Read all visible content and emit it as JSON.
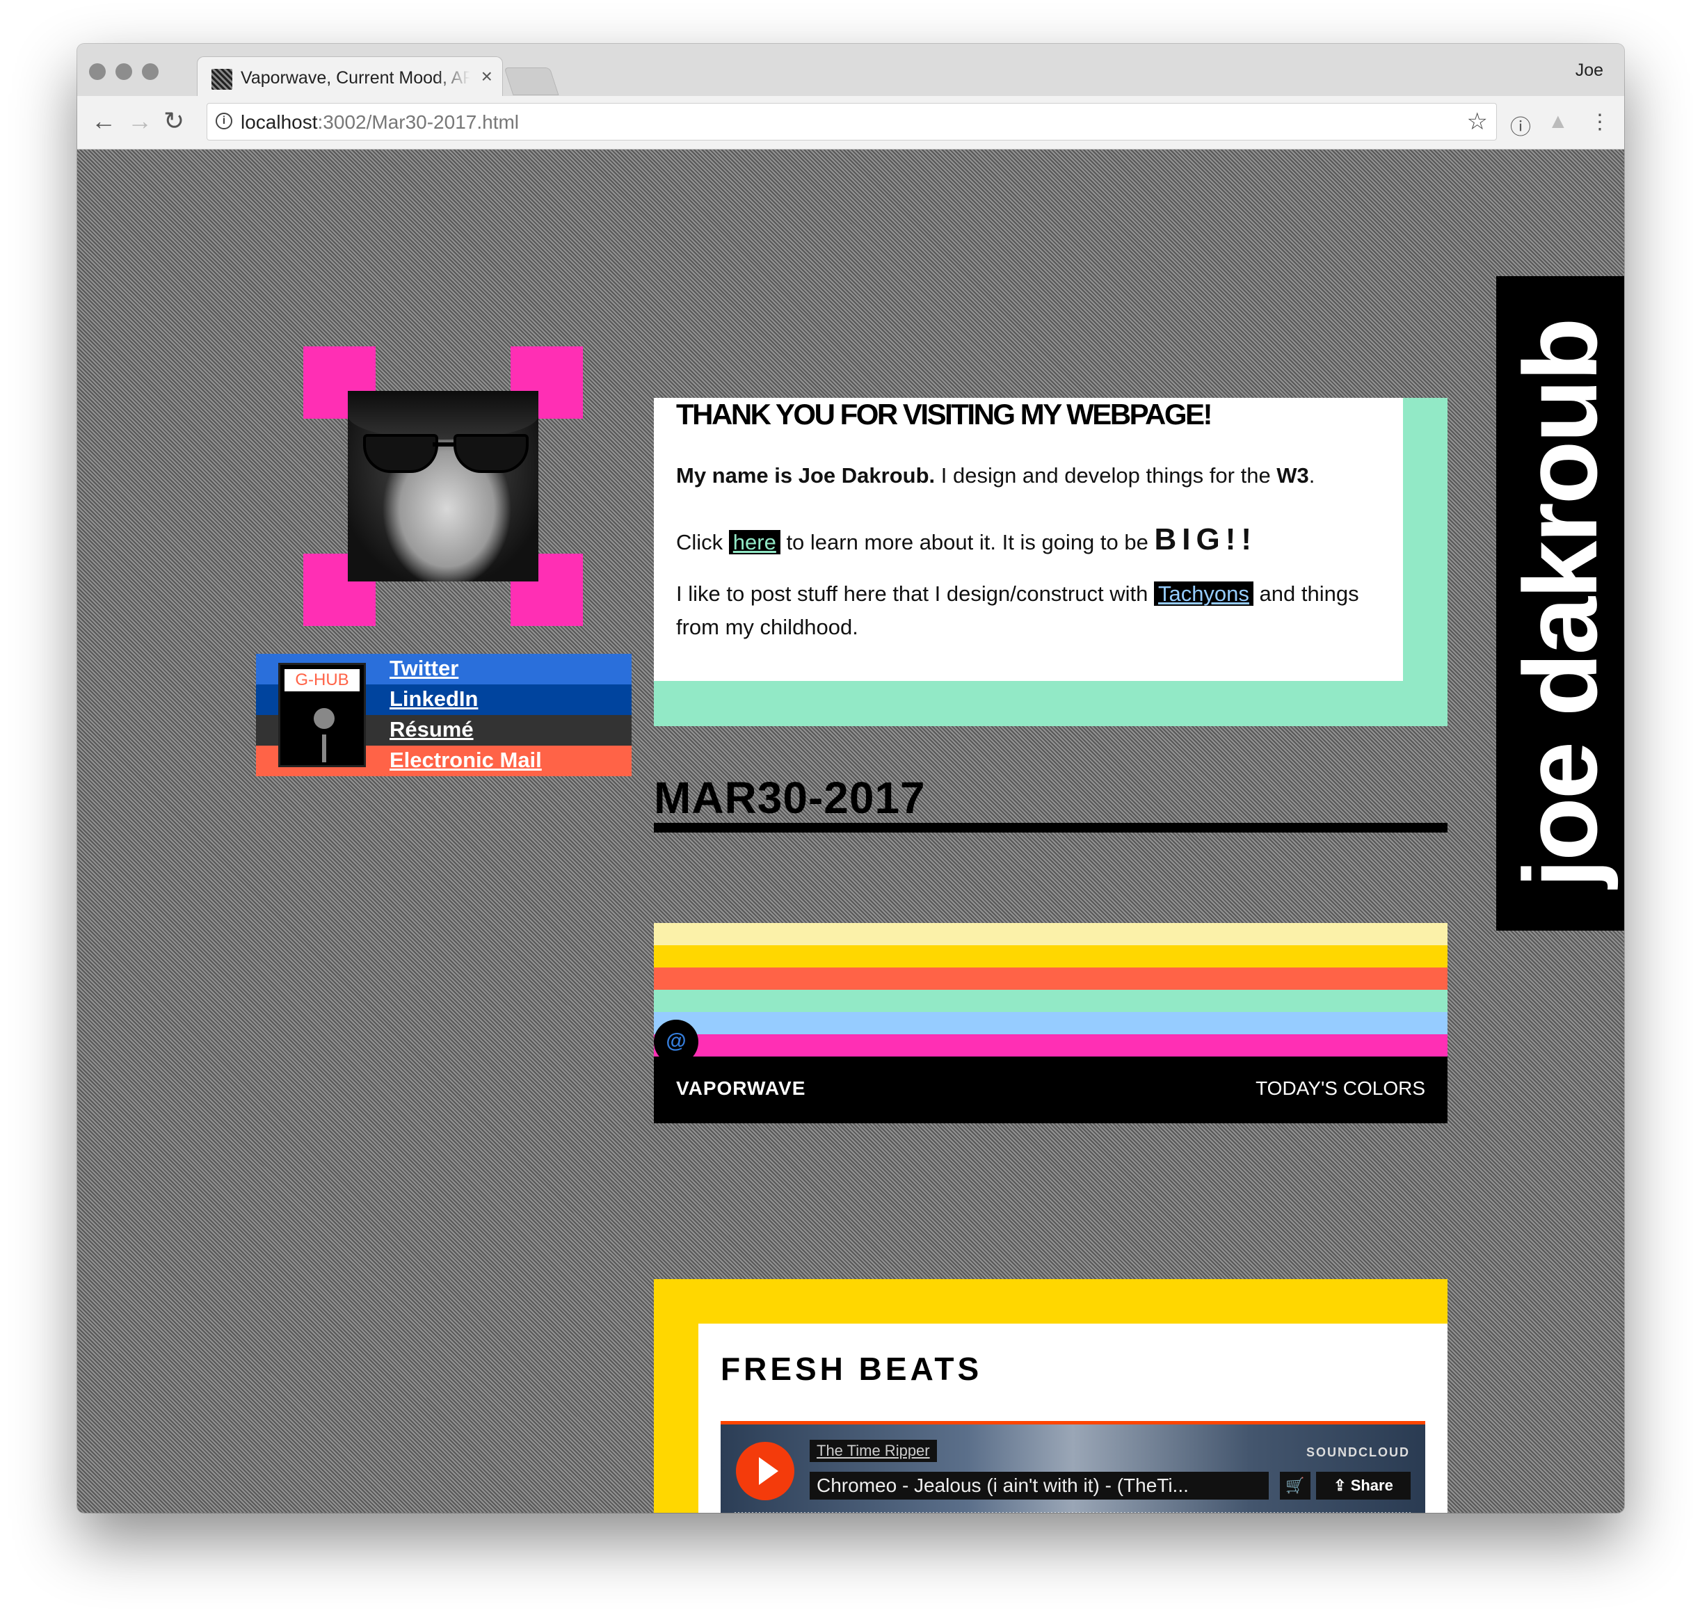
{
  "browser": {
    "tab_title": "Vaporwave, Current Mood, ART",
    "tab_close": "×",
    "profile": "Joe",
    "url_host": "localhost",
    "url_rest": ":3002/Mar30-2017.html",
    "icons": [
      "back-arrow-icon",
      "forward-arrow-icon",
      "reload-icon",
      "info-icon",
      "star-icon",
      "extension-icon",
      "drive-icon",
      "menu-icon"
    ]
  },
  "sidebar": {
    "ghub_label": "G-HUB",
    "links": [
      {
        "label": "Twitter",
        "bg": "#2a6fdb"
      },
      {
        "label": "LinkedIn",
        "bg": "#00449e"
      },
      {
        "label": "Résumé",
        "bg": "#333333"
      },
      {
        "label": "Electronic Mail",
        "bg": "#ff6347"
      }
    ]
  },
  "welcome": {
    "title": "THANK YOU FOR VISITING MY WEBPAGE!",
    "p1_bold": "My name is Joe Dakroub.",
    "p1_rest": " I design and develop things for the ",
    "p1_w3": "W3",
    "p1_end": ".",
    "p2_start": "Click ",
    "p2_link": "here",
    "p2_mid": " to learn more about it. It is going to be ",
    "p2_big": "BIG!!",
    "p3_start": "I like to post stuff here that I design/construct with ",
    "p3_link": "Tachyons",
    "p3_end": " and things from my childhood.",
    "accent": "#92e9c6"
  },
  "post": {
    "date": "MAR30-2017"
  },
  "palette": {
    "colors": [
      "#fbf1a9",
      "#ffd700",
      "#ff6347",
      "#92e9c6",
      "#96ccff",
      "#ff2fb4"
    ],
    "left_label": "VAPORWAVE",
    "right_label": "TODAY'S COLORS",
    "at_label": "@"
  },
  "beats": {
    "title": "FRESH BEATS",
    "artist": "The Time Ripper",
    "track": "Chromeo - Jealous (i ain't with it) - (TheTi...",
    "brand": "SOUNDCLOUD",
    "share_label": "Share",
    "cart": "🛒"
  },
  "name_banner": "joe dakroub"
}
